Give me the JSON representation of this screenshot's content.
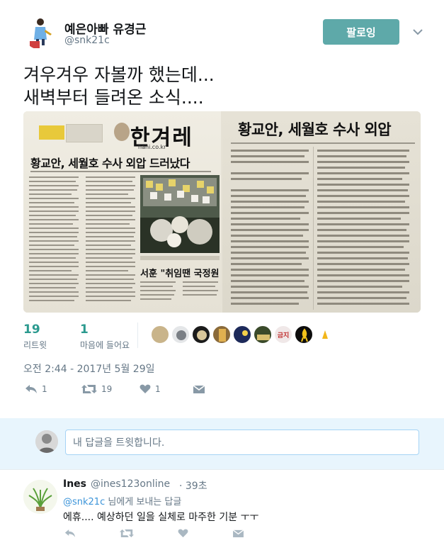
{
  "author": {
    "name": "예은아빠 유경근",
    "handle": "@snk21c"
  },
  "follow_button": "팔로잉",
  "tweet": {
    "line1": "겨우겨우 자볼까 했는데...",
    "line2": "새벽부터 들려온 소식...."
  },
  "media": {
    "left_masthead": "한겨레",
    "left_domain": "hani.co.kr",
    "left_headline": "황교안, 세월호 수사 외압 드러났다",
    "left_caption": "서훈 \"취임땐 국정원 댓글",
    "right_headline": "황교안, 세월호 수사 외압",
    "right_badge": "금지"
  },
  "stats": {
    "retweets": {
      "count": "19",
      "label": "리트윗"
    },
    "likes": {
      "count": "1",
      "label": "마음에 들어요"
    }
  },
  "timestamp": "오전 2:44 - 2017년 5월 29일",
  "actions": {
    "reply_count": "1",
    "retweet_count": "19",
    "like_count": "1"
  },
  "reply_box": {
    "placeholder": "내 답글을 트윗합니다."
  },
  "reply": {
    "name": "Ines",
    "handle": "@ines123online",
    "time": "· 39초",
    "to_mention": "@snk21c",
    "to_suffix": " 님에게 보내는 답글",
    "text": "에휴.... 예상하던 일을 실체로 마주한 기분 ㅜㅜ"
  },
  "colors": {
    "follow_button": "#5ea9a9",
    "link": "#3b94d9",
    "reply_bg": "#e8f5fd",
    "muted": "#657786"
  }
}
